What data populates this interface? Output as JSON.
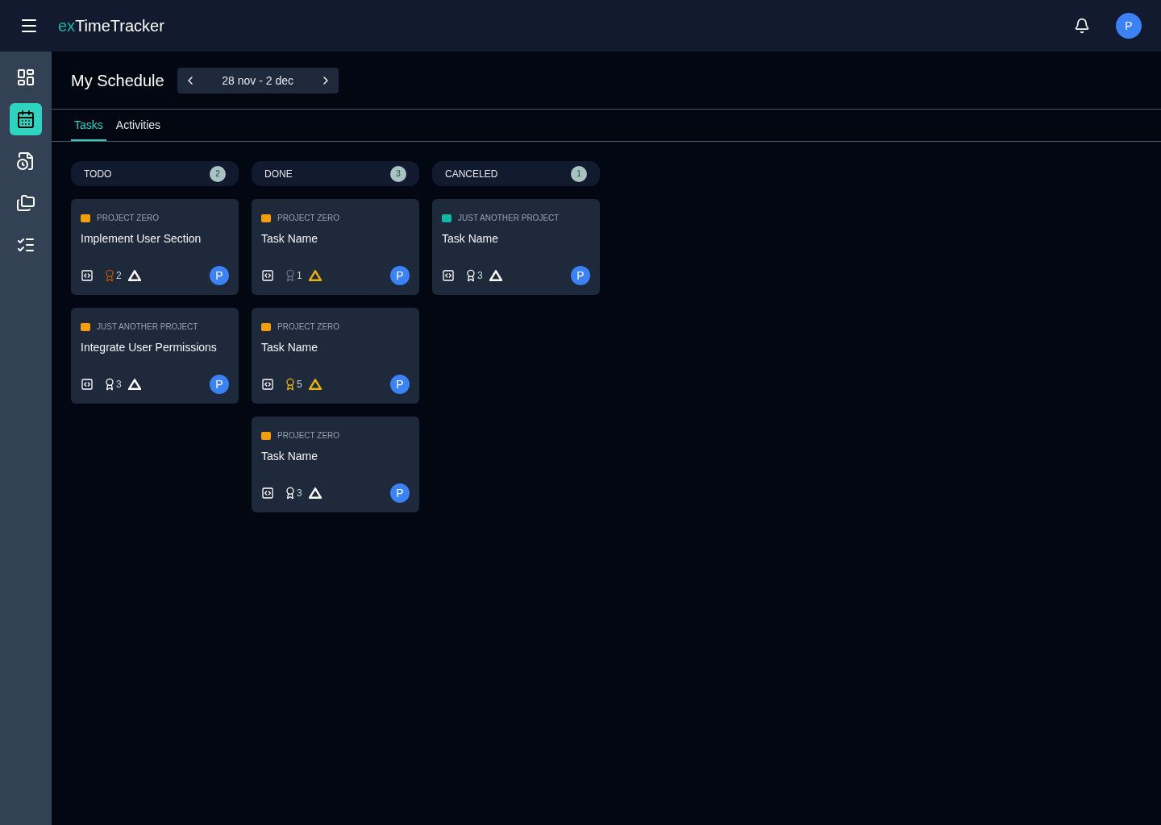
{
  "app": {
    "brand_prefix": "ex",
    "brand_name": "TimeTracker",
    "user_initial": "P"
  },
  "sidebar": {
    "items": [
      {
        "kind": "dashboard",
        "selected": false
      },
      {
        "kind": "calendar",
        "selected": true
      },
      {
        "kind": "report",
        "selected": false
      },
      {
        "kind": "folders",
        "selected": false
      },
      {
        "kind": "list",
        "selected": false
      }
    ]
  },
  "page": {
    "title": "My Schedule",
    "date_range": "28 nov - 2 dec"
  },
  "tabs": [
    {
      "label": "Tasks",
      "selected": true
    },
    {
      "label": "Activities",
      "selected": false
    }
  ],
  "columns": [
    {
      "title": "TODO",
      "count": "2",
      "cards": [
        {
          "project": "PROJECT ZERO",
          "color": "#f59e0b",
          "name": "Implement User Section",
          "points": {
            "value": "2",
            "color": "#b45309"
          },
          "warning": {
            "color": "#ffffff"
          },
          "assignee": "P"
        },
        {
          "project": "JUST ANOTHER PROJECT",
          "color": "#f59e0b",
          "name": "Integrate User Permissions",
          "points": {
            "value": "3",
            "color": "#ffffff"
          },
          "warning": {
            "color": "#ffffff"
          },
          "assignee": "P"
        }
      ]
    },
    {
      "title": "DONE",
      "count": "3",
      "cards": [
        {
          "project": "PROJECT ZERO",
          "color": "#f59e0b",
          "name": "Task Name",
          "points": {
            "value": "1",
            "color": "#6b7280"
          },
          "warning": {
            "color": "#eab308"
          },
          "assignee": "P"
        },
        {
          "project": "PROJECT ZERO",
          "color": "#f59e0b",
          "name": "Task Name",
          "points": {
            "value": "5",
            "color": "#eab308"
          },
          "warning": {
            "color": "#eab308"
          },
          "assignee": "P"
        },
        {
          "project": "PROJECT ZERO",
          "color": "#f59e0b",
          "name": "Task Name",
          "points": {
            "value": "3",
            "color": "#ffffff"
          },
          "warning": {
            "color": "#ffffff"
          },
          "assignee": "P"
        }
      ]
    },
    {
      "title": "CANCELED",
      "count": "1",
      "cards": [
        {
          "project": "JUST ANOTHER PROJECT",
          "color": "#14b8a6",
          "name": "Task Name",
          "points": {
            "value": "3",
            "color": "#ffffff"
          },
          "warning": {
            "color": "#ffffff"
          },
          "assignee": "P"
        }
      ]
    }
  ]
}
